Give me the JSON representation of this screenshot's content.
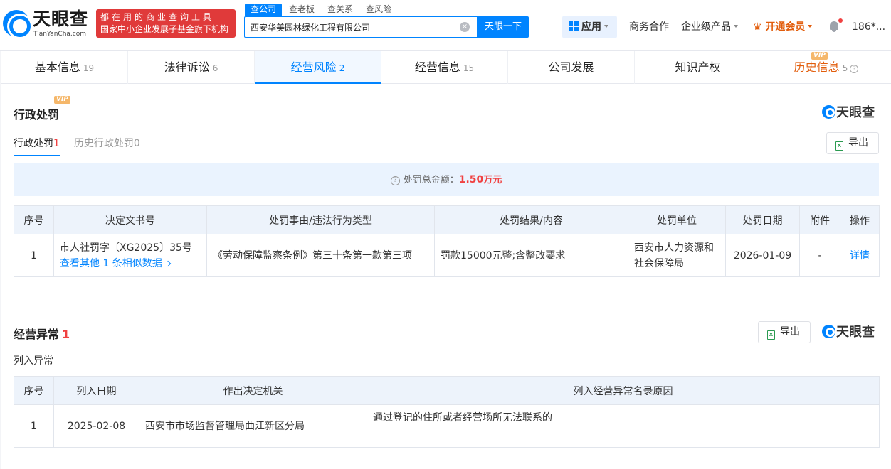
{
  "header": {
    "logo_cn": "天眼查",
    "logo_en": "TianYanCha.com",
    "slogan_line1": "都在用的商业查询工具",
    "slogan_line2": "国家中小企业发展子基金旗下机构",
    "search_tabs": [
      "查公司",
      "查老板",
      "查关系",
      "查风险"
    ],
    "search_value": "西安华美园林绿化工程有限公司",
    "search_button": "天眼一下",
    "nav_app": "应用",
    "nav_business": "商务合作",
    "nav_enterprise": "企业级产品",
    "nav_vip": "开通会员",
    "nav_user": "186*...",
    "accent_color": "#0084ff"
  },
  "tabs": [
    {
      "label": "基本信息",
      "count": "19"
    },
    {
      "label": "法律诉讼",
      "count": "6"
    },
    {
      "label": "经营风险",
      "count": "2"
    },
    {
      "label": "经营信息",
      "count": "15"
    },
    {
      "label": "公司发展",
      "count": ""
    },
    {
      "label": "知识产权",
      "count": ""
    },
    {
      "label": "历史信息",
      "count": "5"
    }
  ],
  "vip_tag": "VIP",
  "brand": "天眼查",
  "admin_penalty": {
    "title": "行政处罚",
    "subtab_current": "行政处罚",
    "subtab_current_count": "1",
    "subtab_history": "历史行政处罚",
    "subtab_history_count": "0",
    "export_label": "导出",
    "summary_label": "处罚总金额：",
    "summary_amount": "1.50",
    "summary_unit": "万元",
    "columns": [
      "序号",
      "决定文书号",
      "处罚事由/违法行为类型",
      "处罚结果/内容",
      "处罚单位",
      "处罚日期",
      "附件",
      "操作"
    ],
    "rows": [
      {
        "index": "1",
        "doc_no": "市人社罚字〔XG2025〕35号",
        "similar_link": "查看其他 1 条相似数据",
        "reason": "《劳动保障监察条例》第三十条第一款第三项",
        "result": "罚款15000元整;含整改要求",
        "authority": "西安市人力资源和社会保障局",
        "date": "2026-01-09",
        "attachment": "-",
        "action": "详情"
      }
    ]
  },
  "abnormal": {
    "title": "经营异常",
    "count": "1",
    "export_label": "导出",
    "sublabel": "列入异常",
    "columns": [
      "序号",
      "列入日期",
      "作出决定机关",
      "列入经营异常名录原因"
    ],
    "rows": [
      {
        "index": "1",
        "date": "2025-02-08",
        "authority": "西安市市场监督管理局曲江新区分局",
        "reason": "通过登记的住所或者经营场所无法联系的"
      }
    ]
  }
}
